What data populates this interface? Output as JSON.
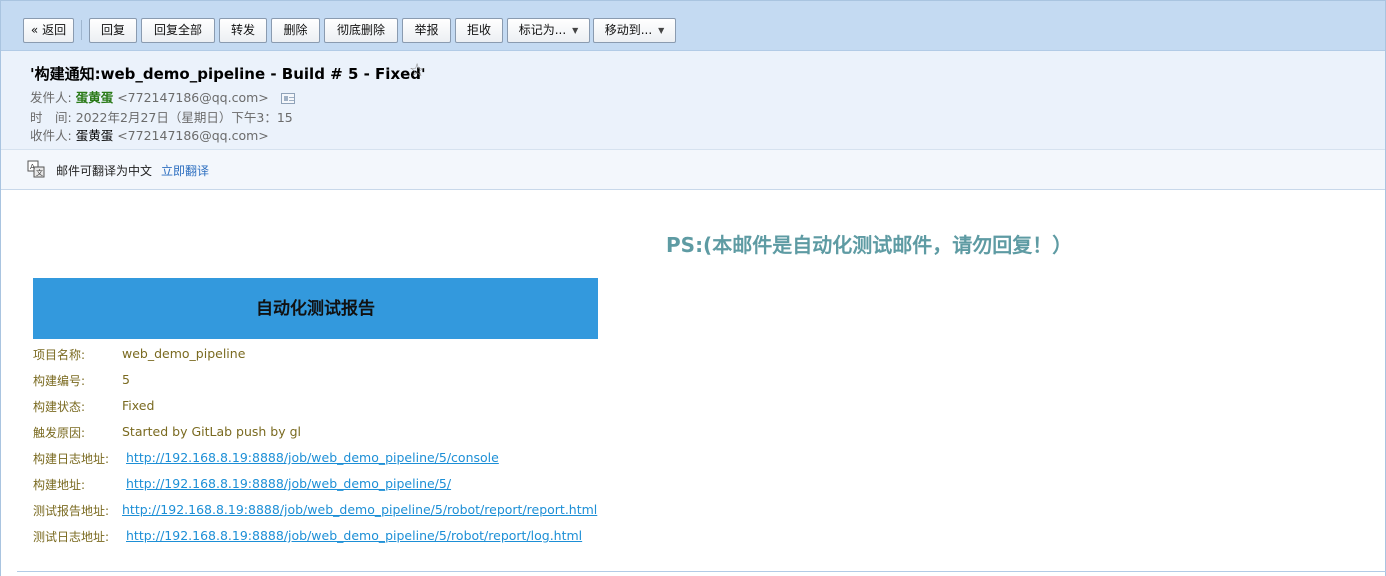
{
  "toolbar": {
    "back": "« 返回",
    "reply": "回复",
    "reply_all": "回复全部",
    "forward": "转发",
    "delete": "删除",
    "delete_forever": "彻底删除",
    "report": "举报",
    "reject": "拒收",
    "mark_as": "标记为...",
    "move_to": "移动到..."
  },
  "header": {
    "subject": "'构建通知:web_demo_pipeline - Build # 5 - Fixed'",
    "star": "☆",
    "from_label": "发件人:",
    "from_name": "蛋黄蛋",
    "from_addr": "<772147186@qq.com>",
    "time_label": "时　间:",
    "time_value": "2022年2月27日（星期日）下午3：15",
    "to_label": "收件人:",
    "to_name": "蛋黄蛋",
    "to_addr": "<772147186@qq.com>"
  },
  "translate": {
    "text": "邮件可翻译为中文",
    "link": "立即翻译"
  },
  "body": {
    "ps": "PS:(本邮件是自动化测试邮件，请勿回复！）",
    "report_title": "自动化测试报告",
    "rows": [
      {
        "key": "项目名称:",
        "value": "web_demo_pipeline",
        "link": false
      },
      {
        "key": "构建编号:",
        "value": "5",
        "link": false
      },
      {
        "key": "构建状态:",
        "value": "Fixed",
        "link": false
      },
      {
        "key": "触发原因:",
        "value": "Started by GitLab push by gl",
        "link": false
      },
      {
        "key": "构建日志地址:",
        "value": "http://192.168.8.19:8888/job/web_demo_pipeline/5/console",
        "link": true
      },
      {
        "key": "构建地址:",
        "value": "http://192.168.8.19:8888/job/web_demo_pipeline/5/",
        "link": true
      },
      {
        "key": "测试报告地址:",
        "value": "http://192.168.8.19:8888/job/web_demo_pipeline/5/robot/report/report.html",
        "link": true
      },
      {
        "key": "测试日志地址:",
        "value": "http://192.168.8.19:8888/job/web_demo_pipeline/5/robot/report/log.html",
        "link": true
      }
    ]
  },
  "colors": {
    "toolbar_bg": "#c4daf2",
    "header_bg": "#ebf2fb",
    "report_header_bg": "#3399dd",
    "ps_color": "#5e9ba3",
    "link_color": "#1d8fd6",
    "sender_color": "#2a7a18"
  },
  "icons": {
    "translate": "translate-icon",
    "contact_card": "contact-card-icon",
    "star": "star-icon"
  }
}
